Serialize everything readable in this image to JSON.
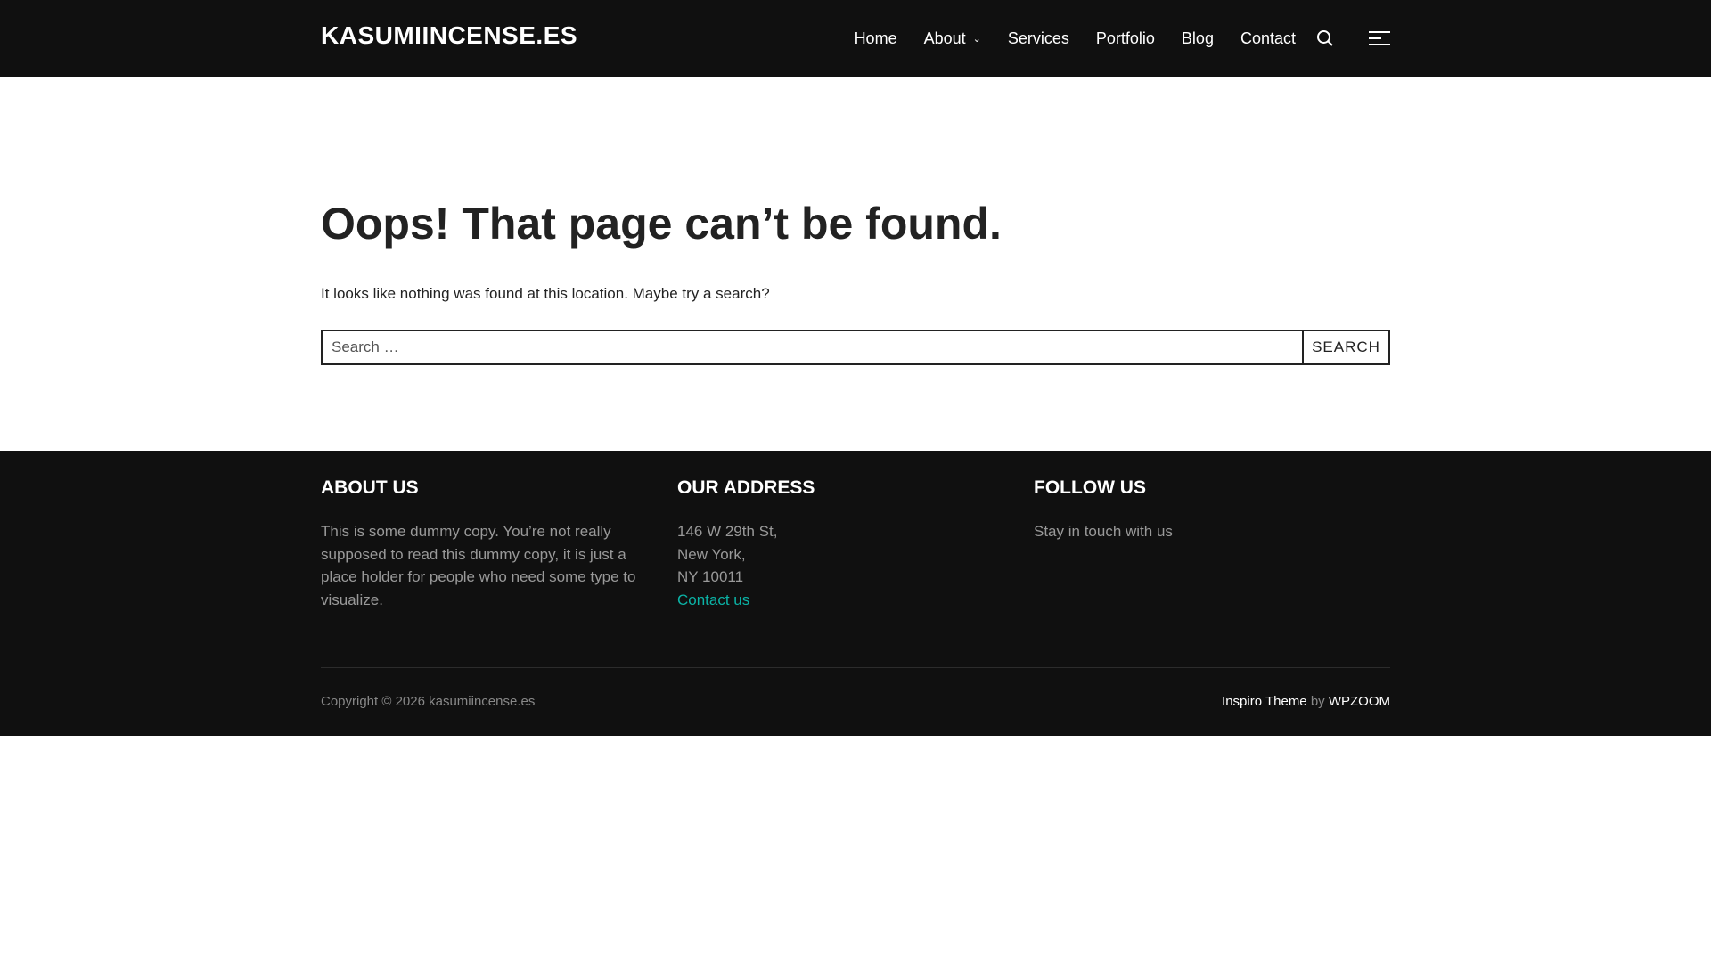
{
  "header": {
    "logo": "KASUMIINCENSE.ES",
    "nav": [
      "Home",
      "About",
      "Services",
      "Portfolio",
      "Blog",
      "Contact"
    ]
  },
  "main": {
    "title": "Oops! That page can’t be found.",
    "lead": "It looks like nothing was found at this location. Maybe try a search?",
    "search_placeholder": "Search …",
    "search_button": "SEARCH"
  },
  "footer": {
    "about": {
      "title": "ABOUT US",
      "text": "This is some dummy copy. You’re not really supposed to read this dummy copy, it is just a place holder for people who need some type to visualize."
    },
    "address": {
      "title": "OUR ADDRESS",
      "lines": [
        "146 W 29th St,",
        "New York,",
        "NY 10011"
      ],
      "link": "Contact us"
    },
    "follow": {
      "title": "FOLLOW US",
      "text": "Stay in touch with us"
    },
    "copyright": "Copyright © 2026 kasumiincense.es",
    "theme": "Inspiro Theme",
    "by": "by",
    "vendor": "WPZOOM"
  },
  "colors": {
    "accent": "#0bb3a6",
    "dark": "#101010"
  }
}
